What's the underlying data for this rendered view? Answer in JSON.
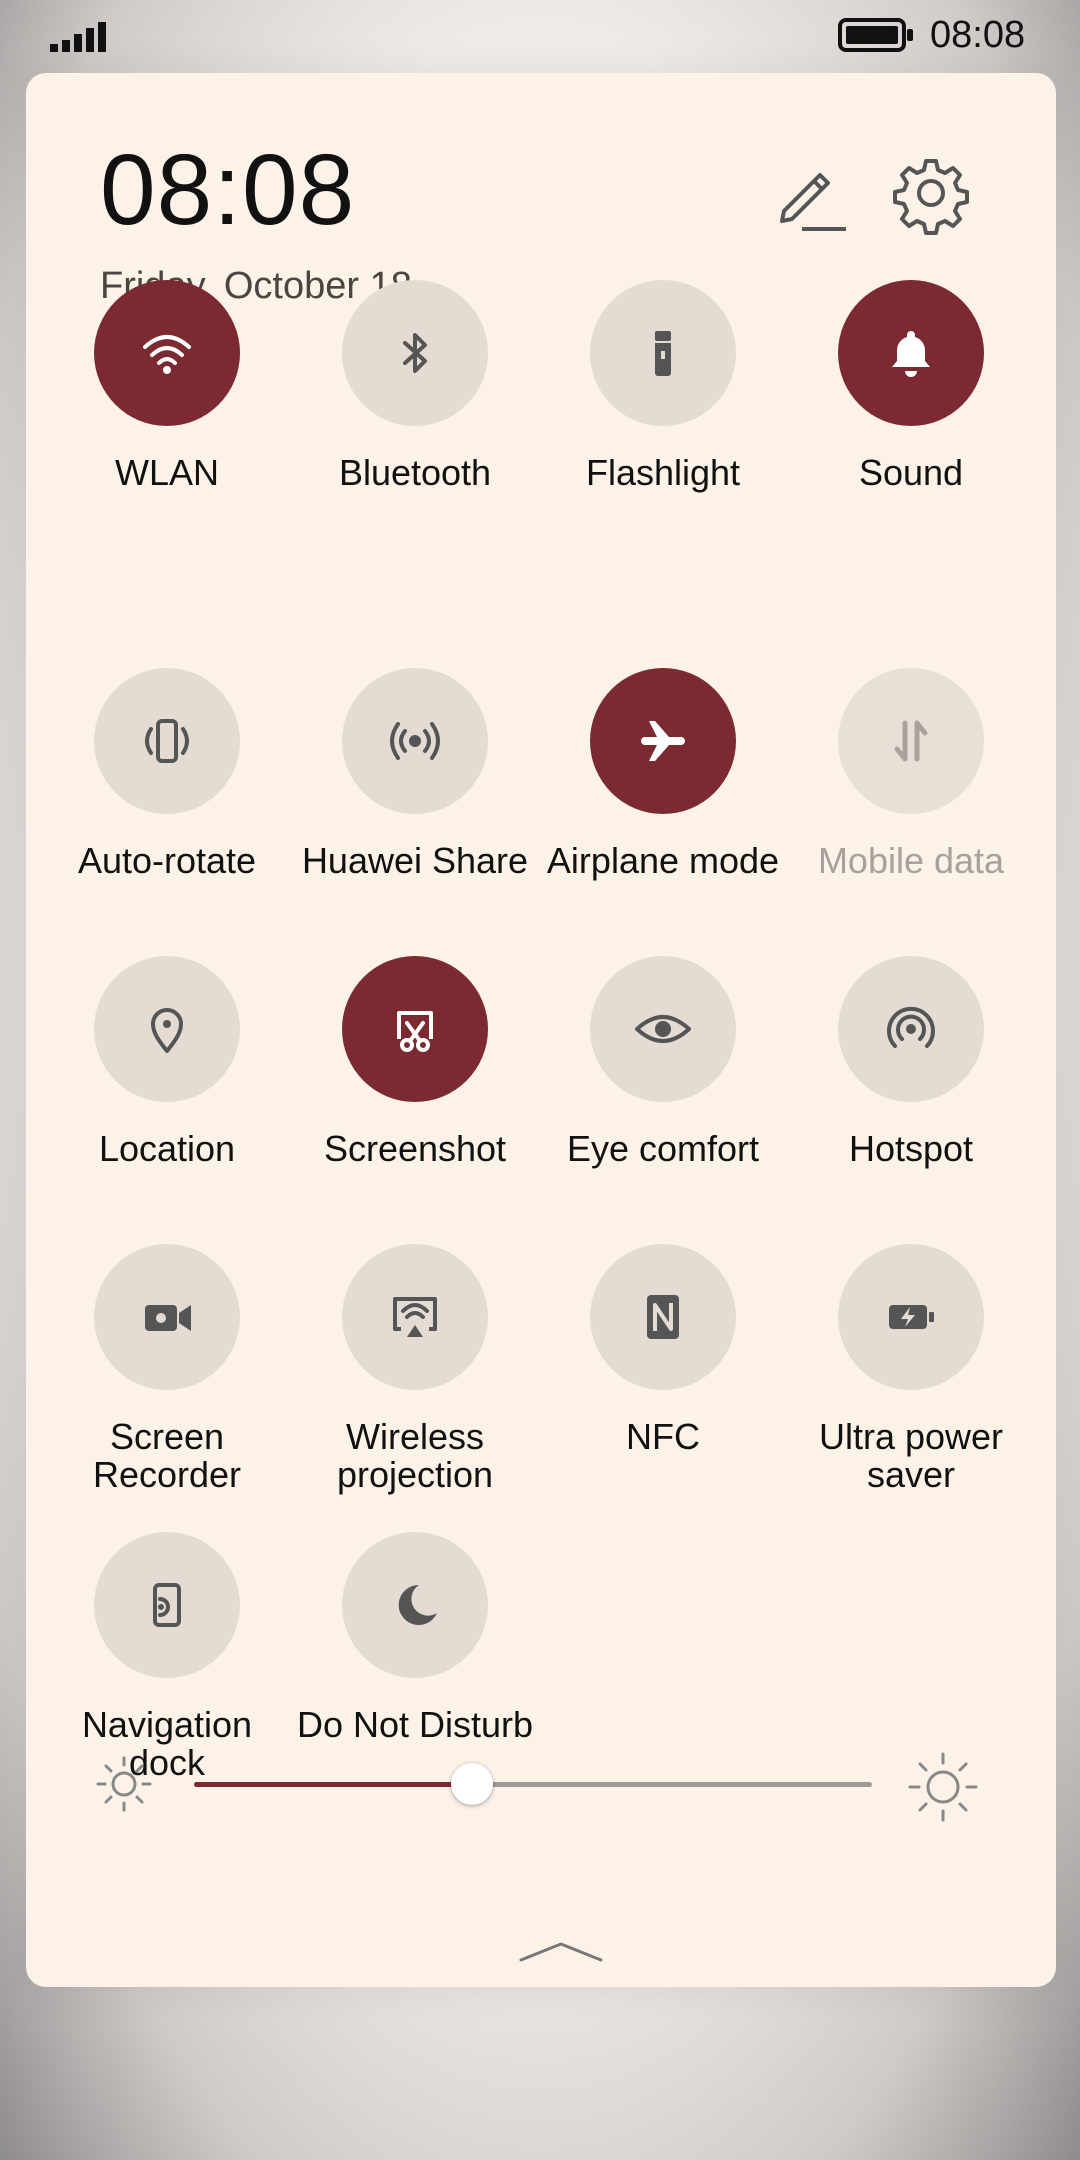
{
  "status_bar": {
    "time": "08:08"
  },
  "header": {
    "clock": "08:08",
    "date": "Friday, October 18"
  },
  "accent_color": "#7b2a31",
  "tiles": [
    {
      "label": "WLAN",
      "icon": "wifi-icon",
      "on": true
    },
    {
      "label": "Bluetooth",
      "icon": "bluetooth-icon",
      "on": false
    },
    {
      "label": "Flashlight",
      "icon": "flashlight-icon",
      "on": false
    },
    {
      "label": "Sound",
      "icon": "bell-icon",
      "on": true
    },
    {
      "label": "Auto-rotate",
      "icon": "auto-rotate-icon",
      "on": false
    },
    {
      "label": "Huawei Share",
      "icon": "huawei-share-icon",
      "on": false
    },
    {
      "label": "Airplane mode",
      "icon": "airplane-icon",
      "on": true
    },
    {
      "label": "Mobile data",
      "icon": "mobile-data-icon",
      "on": false,
      "disabled": true
    },
    {
      "label": "Location",
      "icon": "location-icon",
      "on": false
    },
    {
      "label": "Screenshot",
      "icon": "screenshot-icon",
      "on": true
    },
    {
      "label": "Eye comfort",
      "icon": "eye-icon",
      "on": false
    },
    {
      "label": "Hotspot",
      "icon": "hotspot-icon",
      "on": false
    },
    {
      "label": "Screen Recorder",
      "icon": "screen-recorder-icon",
      "on": false
    },
    {
      "label": "Wireless projection",
      "icon": "wireless-projection-icon",
      "on": false
    },
    {
      "label": "NFC",
      "icon": "nfc-icon",
      "on": false
    },
    {
      "label": "Ultra power saver",
      "icon": "battery-saver-icon",
      "on": false
    },
    {
      "label": "Navigation dock",
      "icon": "navigation-dock-icon",
      "on": false
    },
    {
      "label": "Do Not Disturb",
      "icon": "moon-icon",
      "on": false
    }
  ],
  "brightness": {
    "level_fraction": 0.41
  }
}
